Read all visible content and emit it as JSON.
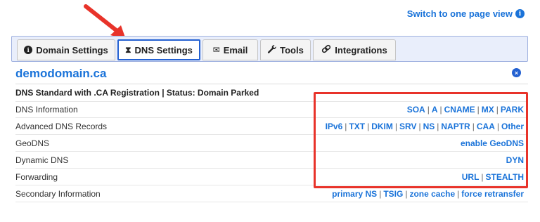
{
  "header": {
    "switch_view_label": "Switch to one page view",
    "info_icon": "i"
  },
  "tabs": [
    {
      "label": "Domain Settings",
      "icon": "info-circle-icon",
      "glyph": "i"
    },
    {
      "label": "DNS Settings",
      "icon": "hourglass-icon",
      "glyph": "⧗"
    },
    {
      "label": "Email",
      "icon": "envelope-icon",
      "glyph": "✉"
    },
    {
      "label": "Tools",
      "icon": "wrench-icon",
      "glyph": "🔧"
    },
    {
      "label": "Integrations",
      "icon": "link-icon",
      "glyph": "🔗"
    }
  ],
  "panel": {
    "domain": "demodomain.ca",
    "subtitle": "DNS Standard with .CA Registration | Status: Domain Parked",
    "close_glyph": "×",
    "rows": [
      {
        "label": "DNS Information",
        "links": [
          "SOA",
          "A",
          "CNAME",
          "MX",
          "PARK"
        ]
      },
      {
        "label": "Advanced DNS Records",
        "links": [
          "IPv6",
          "TXT",
          "DKIM",
          "SRV",
          "NS",
          "NAPTR",
          "CAA",
          "Other"
        ]
      },
      {
        "label": "GeoDNS",
        "links": [
          "enable GeoDNS"
        ]
      },
      {
        "label": "Dynamic DNS",
        "links": [
          "DYN"
        ]
      },
      {
        "label": "Forwarding",
        "links": [
          "URL",
          "STEALTH"
        ]
      },
      {
        "label": "Secondary Information",
        "links": [
          "primary NS",
          "TSIG",
          "zone cache",
          "force retransfer"
        ]
      }
    ]
  },
  "colors": {
    "link": "#1a73d9",
    "highlight": "#e8332a",
    "tab_active_border": "#2461d1"
  }
}
